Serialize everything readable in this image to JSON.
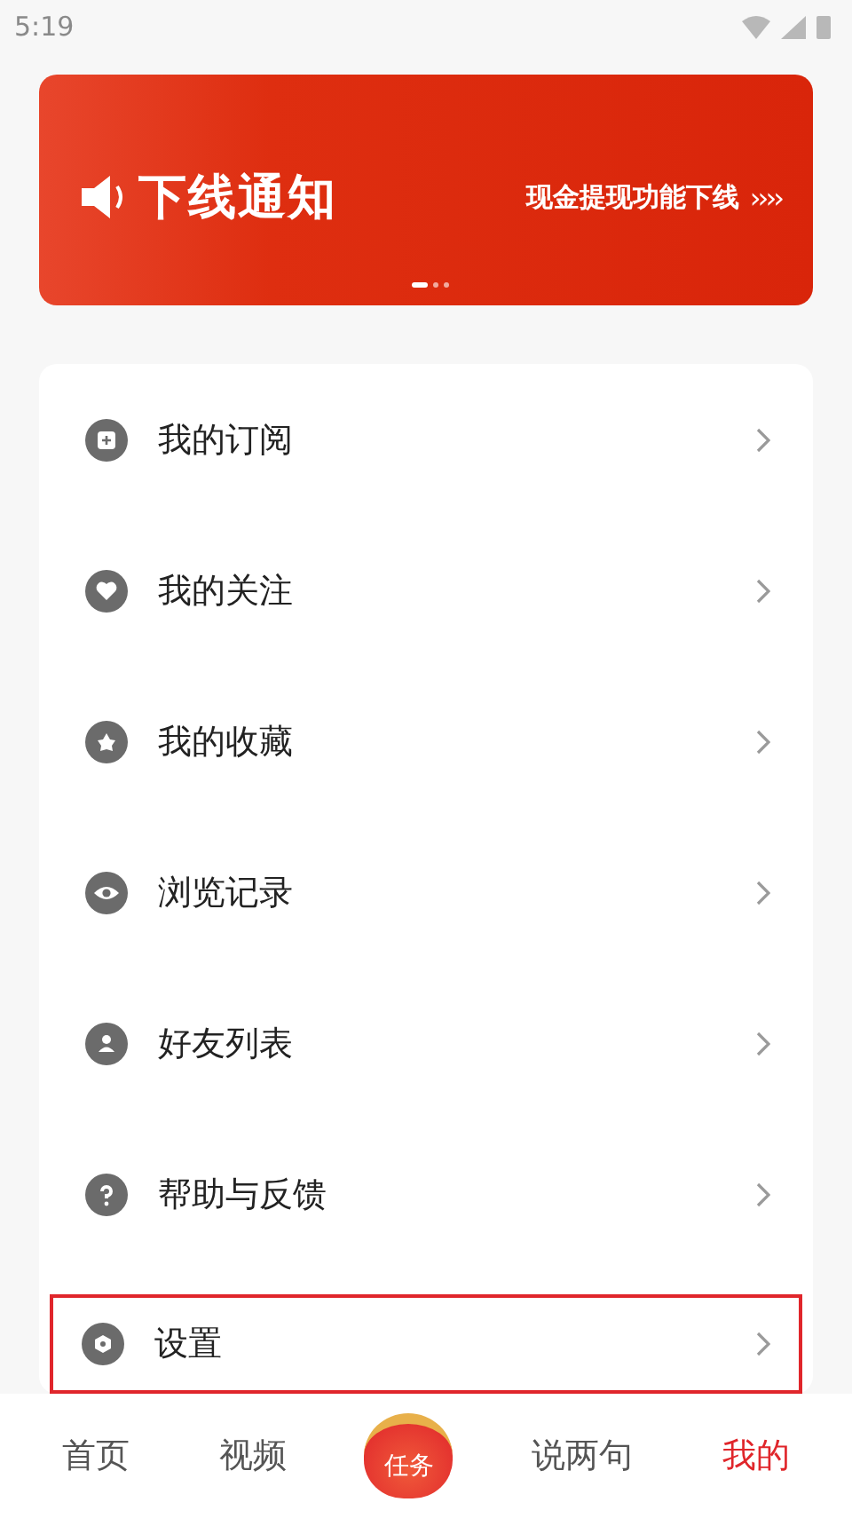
{
  "status_bar": {
    "time": "5:19"
  },
  "banner": {
    "title": "下线通知",
    "subtitle": "现金提现功能下线",
    "arrows": "››››",
    "dots": [
      {
        "selected": true
      },
      {
        "selected": false
      },
      {
        "selected": false
      }
    ]
  },
  "menu": [
    {
      "label": "我的订阅",
      "highlighted": false
    },
    {
      "label": "我的关注",
      "highlighted": false
    },
    {
      "label": "我的收藏",
      "highlighted": false
    },
    {
      "label": "浏览记录",
      "highlighted": false
    },
    {
      "label": "好友列表",
      "highlighted": false
    },
    {
      "label": "帮助与反馈",
      "highlighted": false
    },
    {
      "label": "设置",
      "highlighted": true
    }
  ],
  "tab_bar": [
    {
      "label": "首页",
      "kind": "text",
      "selected": false
    },
    {
      "label": "视频",
      "kind": "text",
      "selected": false
    },
    {
      "label": "任务",
      "kind": "bag",
      "selected": false
    },
    {
      "label": "说两句",
      "kind": "text",
      "selected": false
    },
    {
      "label": "我的",
      "kind": "text",
      "selected": true
    }
  ]
}
